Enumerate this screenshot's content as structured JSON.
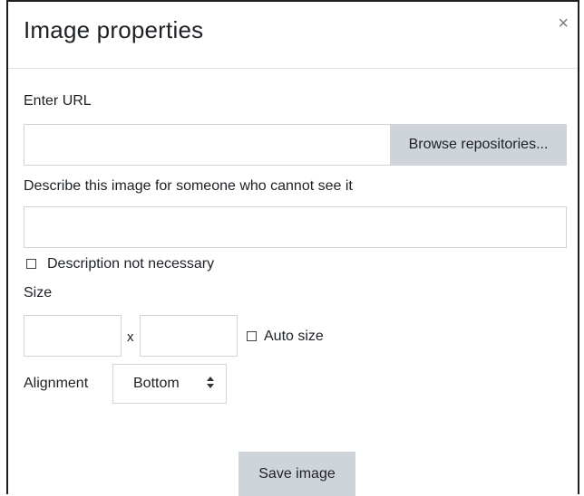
{
  "dialog": {
    "title": "Image properties",
    "close_glyph": "×"
  },
  "url": {
    "label": "Enter URL",
    "value": "",
    "placeholder": "",
    "browse_label": "Browse repositories..."
  },
  "description": {
    "label": "Describe this image for someone who cannot see it",
    "value": "",
    "placeholder": "",
    "not_necessary_label": "Description not necessary",
    "not_necessary_checked": false
  },
  "size": {
    "label": "Size",
    "width_value": "",
    "height_value": "",
    "separator": "x",
    "auto_size_label": "Auto size",
    "auto_size_checked": false
  },
  "alignment": {
    "label": "Alignment",
    "selected": "Bottom"
  },
  "actions": {
    "save_label": "Save image"
  },
  "icons": {
    "close": "close-icon",
    "select_arrow": "sort-arrows-icon"
  }
}
